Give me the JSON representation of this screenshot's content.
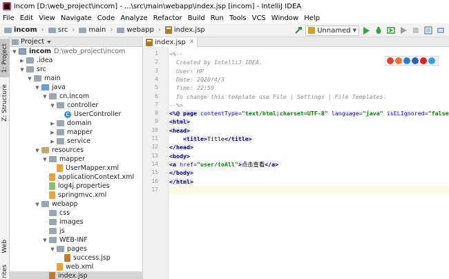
{
  "window": {
    "title": "incom [D:\\web_project\\incom] - ...\\src\\main\\webapp\\index.jsp [incom] - IntelliJ IDEA"
  },
  "menu": [
    "File",
    "Edit",
    "View",
    "Navigate",
    "Code",
    "Analyze",
    "Refactor",
    "Build",
    "Run",
    "Tools",
    "VCS",
    "Window",
    "Help"
  ],
  "breadcrumbs": [
    "incom",
    "src",
    "main",
    "webapp",
    "index.jsp"
  ],
  "run_config": {
    "label": "Unnamed"
  },
  "side_tabs": {
    "project": "1: Project",
    "structure": "Z: Structure",
    "web": "Web",
    "favorites": "rites"
  },
  "project_panel": {
    "title": "Project"
  },
  "tree": [
    {
      "label": "incom",
      "path": "D:\\web_project\\incom",
      "arrow": "▼",
      "icon": "module"
    },
    {
      "label": ".idea",
      "arrow": "▶",
      "icon": "folder"
    },
    {
      "label": "src",
      "arrow": "▼",
      "icon": "folder"
    },
    {
      "label": "main",
      "arrow": "▼",
      "icon": "folder"
    },
    {
      "label": "java",
      "arrow": "▼",
      "icon": "source"
    },
    {
      "label": "cn.incom",
      "arrow": "▼",
      "icon": "folder"
    },
    {
      "label": "controller",
      "arrow": "▼",
      "icon": "folder"
    },
    {
      "label": "UserController",
      "arrow": "",
      "icon": "class"
    },
    {
      "label": "domain",
      "arrow": "▶",
      "icon": "folder"
    },
    {
      "label": "mapper",
      "arrow": "▶",
      "icon": "folder"
    },
    {
      "label": "service",
      "arrow": "▶",
      "icon": "folder"
    },
    {
      "label": "resources",
      "arrow": "▼",
      "icon": "resource"
    },
    {
      "label": "mapper",
      "arrow": "▼",
      "icon": "folder"
    },
    {
      "label": "UserMapper.xml",
      "arrow": "",
      "icon": "xml"
    },
    {
      "label": "applicationContext.xml",
      "arrow": "",
      "icon": "xml"
    },
    {
      "label": "log4j.properties",
      "arrow": "",
      "icon": "props"
    },
    {
      "label": "springmvc.xml",
      "arrow": "",
      "icon": "xml"
    },
    {
      "label": "webapp",
      "arrow": "▼",
      "icon": "webapp"
    },
    {
      "label": "css",
      "arrow": "",
      "icon": "folder"
    },
    {
      "label": "images",
      "arrow": "",
      "icon": "folder"
    },
    {
      "label": "js",
      "arrow": "",
      "icon": "folder"
    },
    {
      "label": "WEB-INF",
      "arrow": "▼",
      "icon": "folder"
    },
    {
      "label": "pages",
      "arrow": "▼",
      "icon": "folder"
    },
    {
      "label": "success.jsp",
      "arrow": "",
      "icon": "jsp"
    },
    {
      "label": "web.xml",
      "arrow": "",
      "icon": "xml"
    },
    {
      "label": "index.jsp",
      "arrow": "",
      "icon": "jsp"
    }
  ],
  "editor_tab": {
    "label": "index.jsp"
  },
  "line_numbers": [
    "1",
    "2",
    "3",
    "4",
    "5",
    "6",
    "7",
    "8",
    "9",
    "10",
    "11",
    "12",
    "13",
    "14",
    "15",
    "16",
    "17"
  ],
  "code": {
    "l1": "<%--",
    "l2": "  Created by IntelliJ IDEA.",
    "l3": "  User: HP",
    "l4": "  Date: 2020/4/3",
    "l5": "  Time: 22:59",
    "l6": "  To change this template use File | Settings | File Templates.",
    "l7": "--%>",
    "l8_dir": "<%@ page ",
    "l8_a1": "contentType=",
    "l8_v1": "\"text/html;charset=UTF-8\"",
    "l8_a2": " language=",
    "l8_v2": "\"java\"",
    "l8_a3": " isELIgnored=",
    "l8_v3": "\"false\"",
    "l8_end": " %>",
    "l9": "<html>",
    "l10": "<head>",
    "l11_open": "<title>",
    "l11_text": "Title",
    "l11_close": "</title>",
    "l12": "</head>",
    "l13": "<body>",
    "l14_open": "<a ",
    "l14_attr": "href=",
    "l14_val": "\"user/toAll\"",
    "l14_gt": ">",
    "l14_text": "点击查看",
    "l14_close": "</a>",
    "l15": "</body>",
    "l16": "</html>"
  },
  "colors": {
    "comment": "#8c8c8c",
    "tag": "#000080",
    "string": "#008000",
    "attr": "#0000ff",
    "run": "#3ca03c"
  }
}
